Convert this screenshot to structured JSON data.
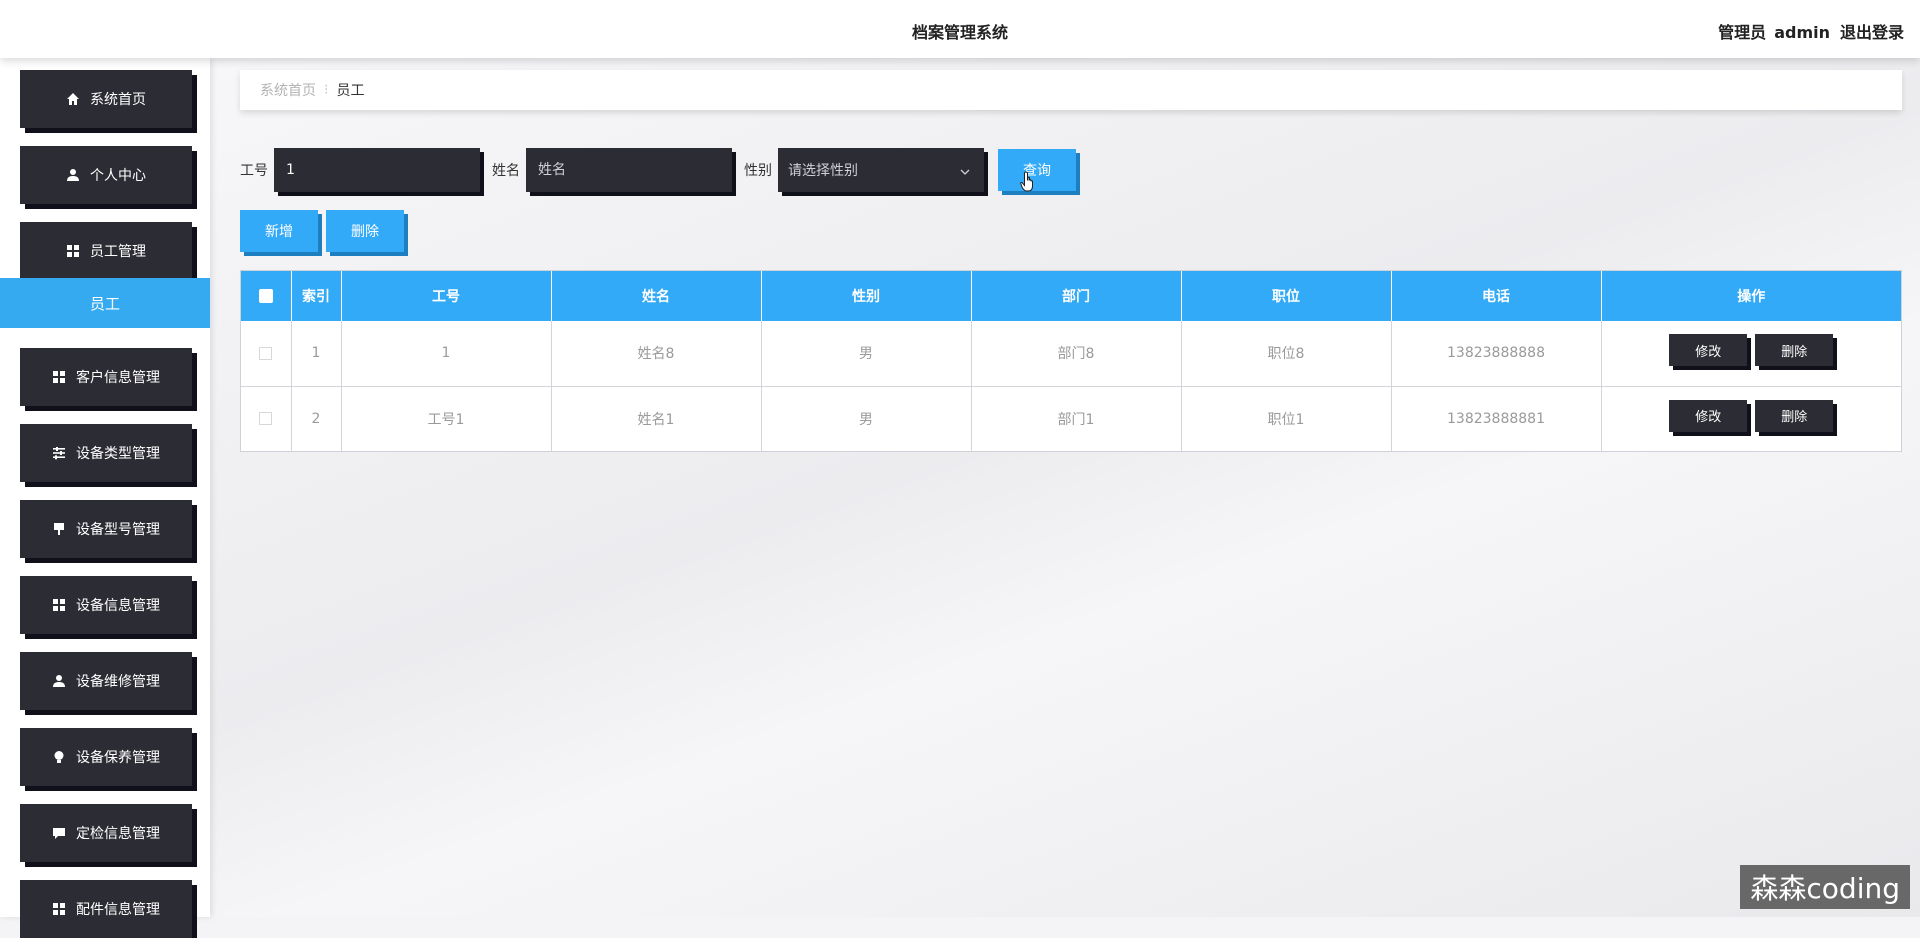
{
  "app": {
    "title": "档案管理系统",
    "user_role": "管理员",
    "user_name": "admin",
    "logout_label": "退出登录"
  },
  "sidebar": {
    "items": [
      {
        "label": "系统首页",
        "icon": "home-icon"
      },
      {
        "label": "个人中心",
        "icon": "user-icon"
      },
      {
        "label": "员工管理",
        "icon": "grid-icon"
      },
      {
        "label": "客户信息管理",
        "icon": "grid-icon"
      },
      {
        "label": "设备类型管理",
        "icon": "sliders-icon"
      },
      {
        "label": "设备型号管理",
        "icon": "pin-icon"
      },
      {
        "label": "设备信息管理",
        "icon": "grid-icon"
      },
      {
        "label": "设备维修管理",
        "icon": "user-icon"
      },
      {
        "label": "设备保养管理",
        "icon": "bulb-icon"
      },
      {
        "label": "定检信息管理",
        "icon": "chat-icon"
      },
      {
        "label": "配件信息管理",
        "icon": "grid-icon"
      }
    ],
    "active_sub": "员工"
  },
  "breadcrumb": {
    "home": "系统首页",
    "separator": "⁝",
    "current": "员工"
  },
  "search": {
    "id_label": "工号",
    "id_value": "1",
    "name_label": "姓名",
    "name_placeholder": "姓名",
    "gender_label": "性别",
    "gender_placeholder": "请选择性别",
    "query_label": "查询"
  },
  "actions": {
    "add_label": "新增",
    "delete_label": "删除"
  },
  "table": {
    "columns": [
      "",
      "索引",
      "工号",
      "姓名",
      "性别",
      "部门",
      "职位",
      "电话",
      "操作"
    ],
    "rows": [
      {
        "index": "1",
        "id": "1",
        "name": "姓名8",
        "gender": "男",
        "dept": "部门8",
        "position": "职位8",
        "phone": "13823888888"
      },
      {
        "index": "2",
        "id": "工号1",
        "name": "姓名1",
        "gender": "男",
        "dept": "部门1",
        "position": "职位1",
        "phone": "13823888881"
      }
    ],
    "edit_label": "修改",
    "delete_label": "删除"
  },
  "watermark": "森森coding",
  "colors": {
    "accent_blue": "#33aaf7",
    "dark_button": "#2c2c34"
  }
}
